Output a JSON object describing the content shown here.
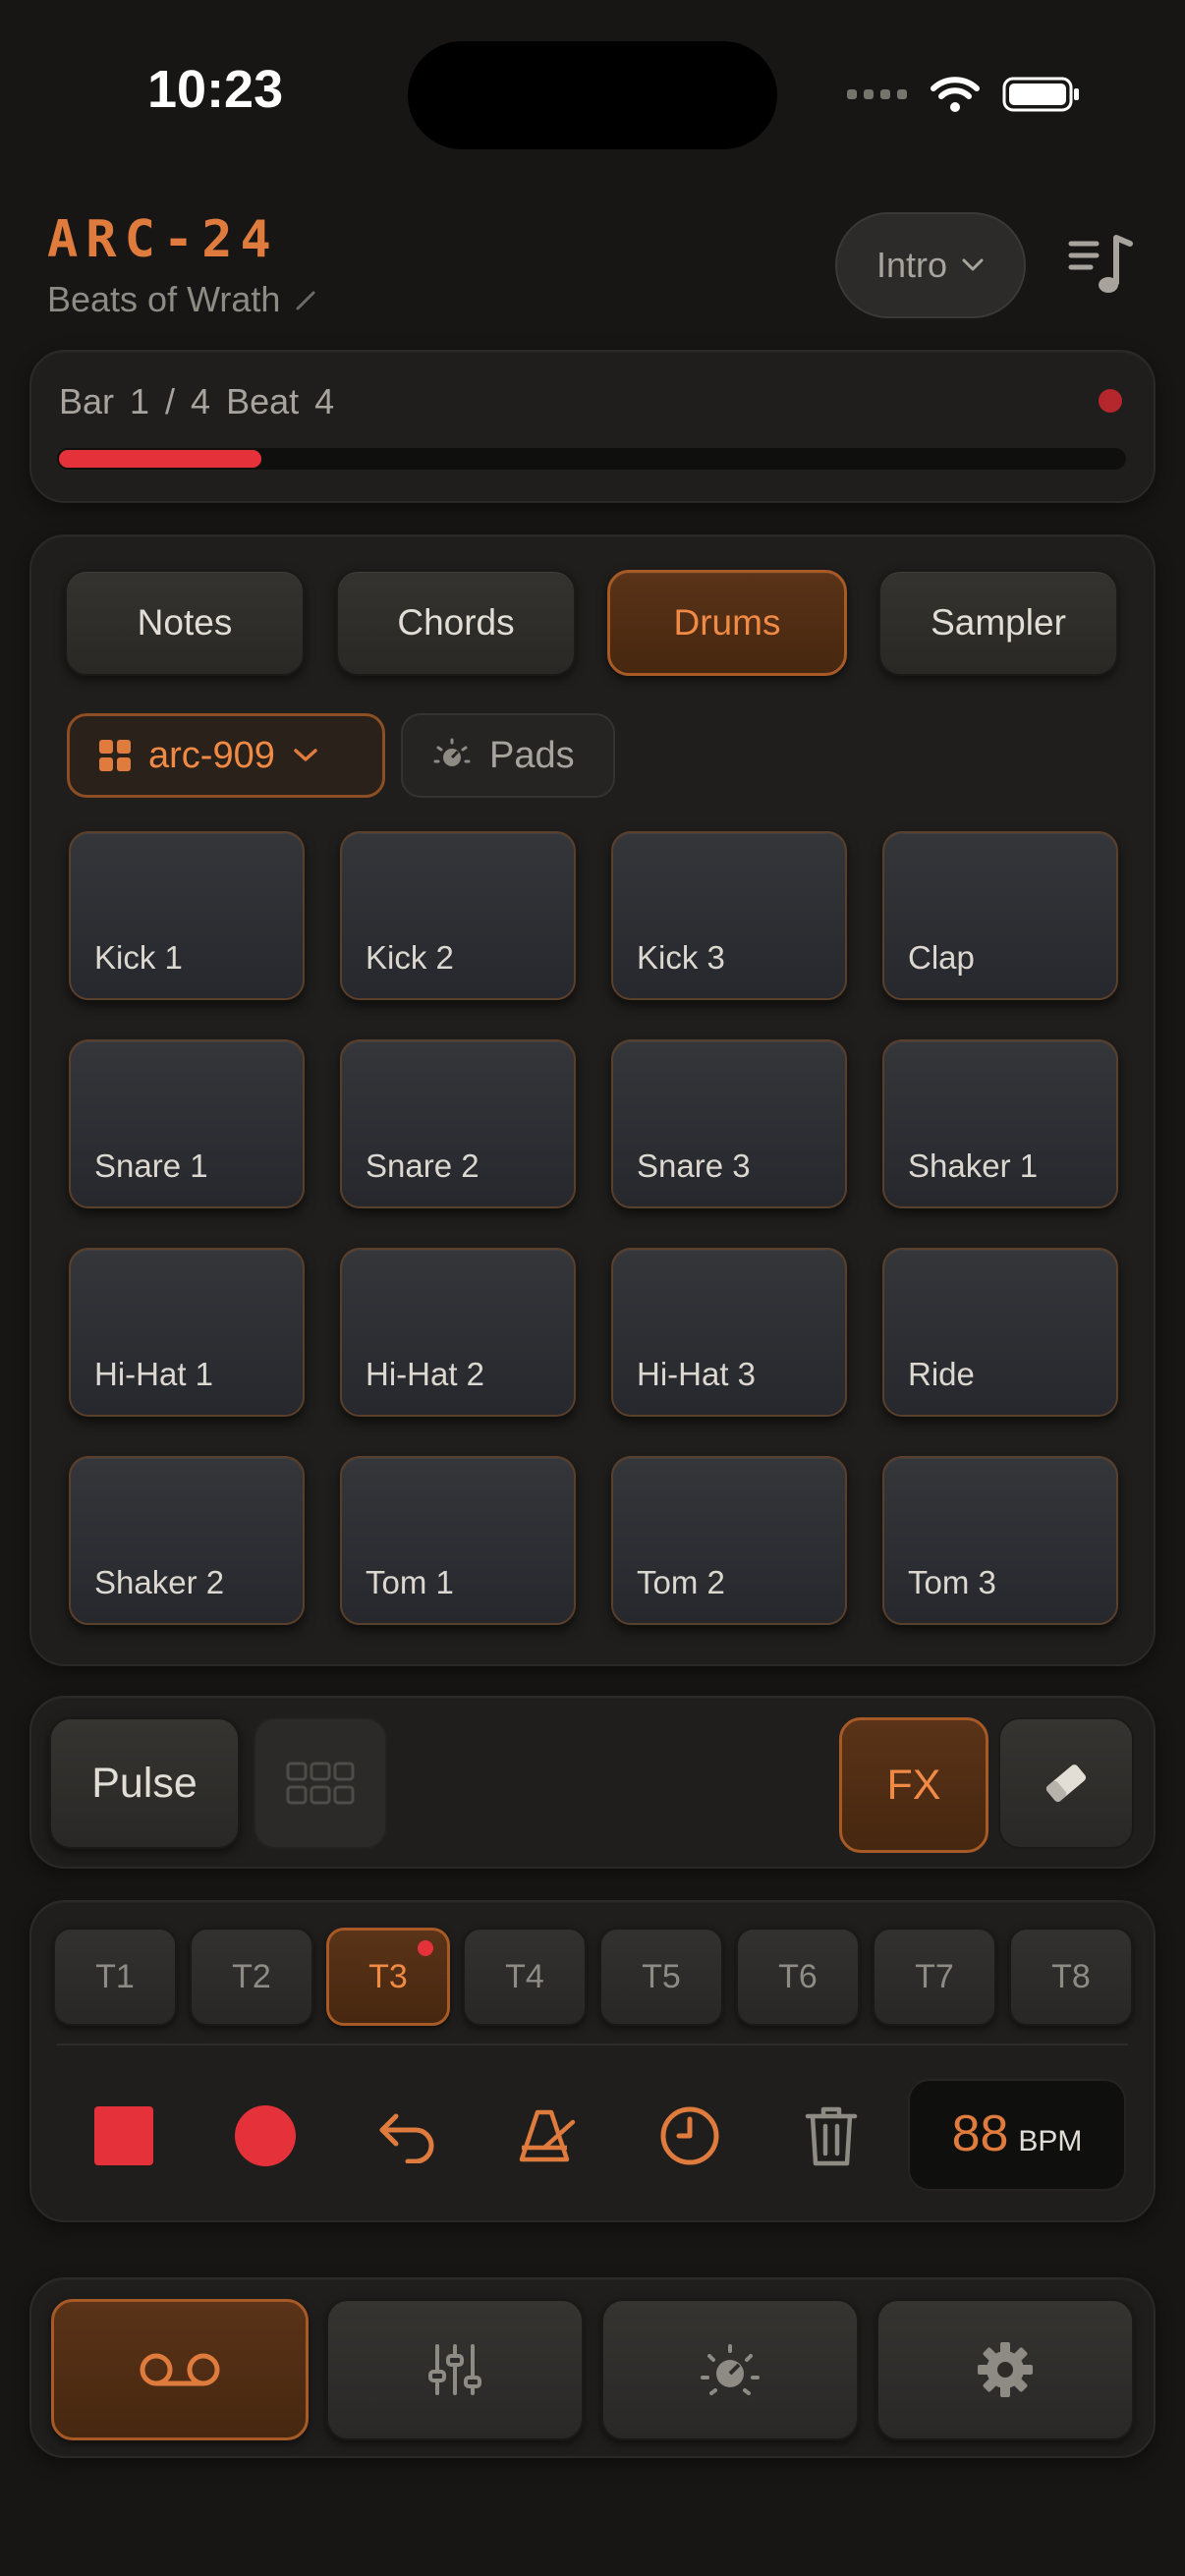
{
  "status_bar": {
    "time": "10:23"
  },
  "header": {
    "app_name": "ARC-24",
    "song_name": "Beats of Wrath",
    "section": "Intro"
  },
  "transport": {
    "position_label": "Bar 1 / 4   Beat 4",
    "progress": 0.19
  },
  "mode_tabs": [
    {
      "label": "Notes",
      "active": false
    },
    {
      "label": "Chords",
      "active": false
    },
    {
      "label": "Drums",
      "active": true
    },
    {
      "label": "Sampler",
      "active": false
    }
  ],
  "kit": {
    "name": "arc-909",
    "view": "Pads"
  },
  "pads": [
    "Kick 1",
    "Kick 2",
    "Kick 3",
    "Clap",
    "Snare 1",
    "Snare 2",
    "Snare 3",
    "Shaker 1",
    "Hi-Hat 1",
    "Hi-Hat 2",
    "Hi-Hat 3",
    "Ride",
    "Shaker 2",
    "Tom 1",
    "Tom 2",
    "Tom 3"
  ],
  "controls": {
    "pulse_label": "Pulse",
    "fx_label": "FX"
  },
  "tracks": [
    {
      "label": "T1"
    },
    {
      "label": "T2"
    },
    {
      "label": "T3",
      "active": true,
      "recording": true
    },
    {
      "label": "T4"
    },
    {
      "label": "T5"
    },
    {
      "label": "T6"
    },
    {
      "label": "T7"
    },
    {
      "label": "T8"
    }
  ],
  "toolbar_icons": [
    "stop-icon",
    "record-icon",
    "undo-icon",
    "metronome-icon",
    "clock-icon",
    "trash-icon"
  ],
  "tempo": {
    "value": "88",
    "unit": "BPM"
  },
  "bottom_nav": [
    {
      "icon": "tape-icon",
      "active": true
    },
    {
      "icon": "mixer-icon",
      "active": false
    },
    {
      "icon": "knob-icon",
      "active": false
    },
    {
      "icon": "gear-icon",
      "active": false
    }
  ],
  "colors": {
    "accent": "#e07b3e",
    "record": "#e5323a",
    "background": "#171615"
  }
}
